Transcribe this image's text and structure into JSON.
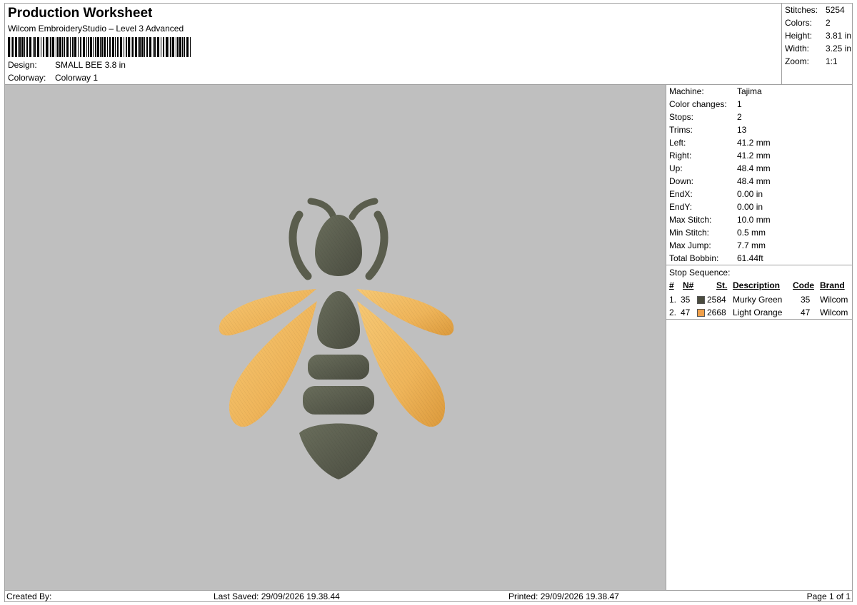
{
  "header": {
    "title": "Production Worksheet",
    "software": "Wilcom EmbroideryStudio – Level 3 Advanced",
    "design_label": "Design:",
    "design_value": "SMALL BEE 3.8 in",
    "colorway_label": "Colorway:",
    "colorway_value": "Colorway 1"
  },
  "stats": {
    "stitches_label": "Stitches:",
    "stitches_value": "5254",
    "colors_label": "Colors:",
    "colors_value": "2",
    "height_label": "Height:",
    "height_value": "3.81 in",
    "width_label": "Width:",
    "width_value": "3.25 in",
    "zoom_label": "Zoom:",
    "zoom_value": "1:1"
  },
  "machine": [
    {
      "label": "Machine:",
      "value": "Tajima"
    },
    {
      "label": "Color changes:",
      "value": "1"
    },
    {
      "label": "Stops:",
      "value": "2"
    },
    {
      "label": "Trims:",
      "value": "13"
    },
    {
      "label": "Left:",
      "value": "41.2 mm"
    },
    {
      "label": "Right:",
      "value": "41.2 mm"
    },
    {
      "label": "Up:",
      "value": "48.4 mm"
    },
    {
      "label": "Down:",
      "value": "48.4 mm"
    },
    {
      "label": "EndX:",
      "value": "0.00 in"
    },
    {
      "label": "EndY:",
      "value": "0.00 in"
    },
    {
      "label": "Max Stitch:",
      "value": "10.0 mm"
    },
    {
      "label": "Min Stitch:",
      "value": "0.5 mm"
    },
    {
      "label": "Max Jump:",
      "value": "7.7 mm"
    },
    {
      "label": "Total Bobbin:",
      "value": "61.44ft"
    }
  ],
  "stop_sequence": {
    "title": "Stop Sequence:",
    "headers": {
      "num": "#",
      "n": "N#",
      "st": "St.",
      "desc": "Description",
      "code": "Code",
      "brand": "Brand"
    },
    "rows": [
      {
        "num": "1.",
        "n": "35",
        "color": "#4b4c3f",
        "st": "2584",
        "desc": "Murky Green",
        "code": "35",
        "brand": "Wilcom"
      },
      {
        "num": "2.",
        "n": "47",
        "color": "#f0a04a",
        "st": "2668",
        "desc": "Light Orange",
        "code": "47",
        "brand": "Wilcom"
      }
    ]
  },
  "footer": {
    "created": "Created By:",
    "saved": "Last Saved: 29/09/2026 19.38.44",
    "printed": "Printed: 29/09/2026 19.38.47",
    "page": "Page 1 of 1"
  },
  "colors": {
    "thread_green": "#5f6352",
    "thread_green_dark": "#45473b",
    "thread_orange": "#f2bd63",
    "thread_orange_dark": "#d99a3a",
    "canvas": "#bfbfbf"
  }
}
